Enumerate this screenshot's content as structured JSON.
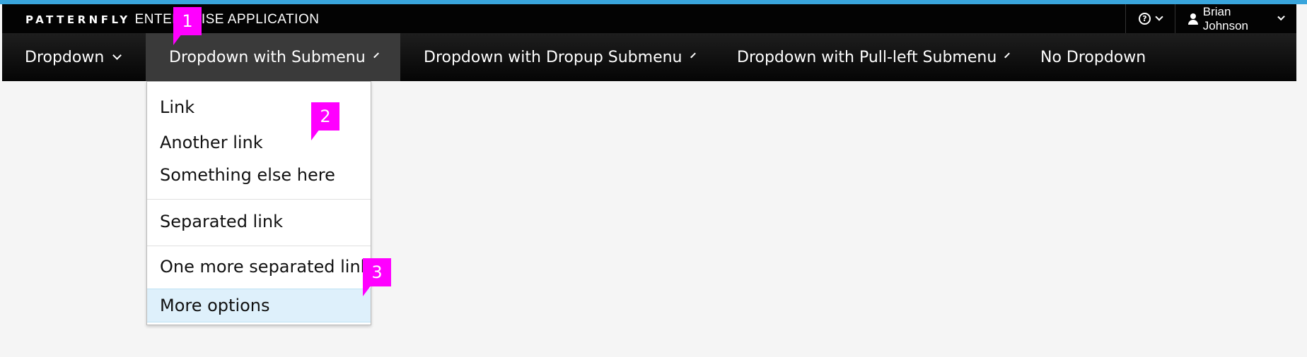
{
  "brand": {
    "bold": "PATTERNFLY",
    "light": "ENTERPRISE APPLICATION"
  },
  "utility": {
    "help_icon": "question-circle-icon",
    "user_name": "Brian Johnson",
    "user_icon": "user-icon"
  },
  "nav": {
    "items": [
      {
        "label": "Dropdown"
      },
      {
        "label": "Dropdown with Submenu"
      },
      {
        "label": "Dropdown with Dropup Submenu"
      },
      {
        "label": "Dropdown with Pull-left Submenu"
      },
      {
        "label": "No Dropdown"
      }
    ]
  },
  "dropdown": {
    "items": [
      {
        "label": "Link"
      },
      {
        "label": "Another link"
      },
      {
        "label": "Something else here"
      },
      {
        "label": "Separated link"
      },
      {
        "label": "One more separated link"
      },
      {
        "label": "More options"
      }
    ]
  },
  "callouts": [
    "1",
    "2",
    "3"
  ],
  "colors": {
    "accent_line": "#39a5dc",
    "callout": "#ff00ff",
    "hover_bg": "#def0fb"
  }
}
